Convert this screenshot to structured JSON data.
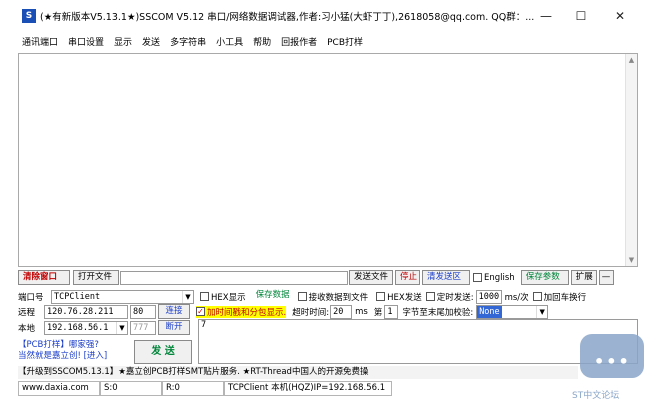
{
  "window": {
    "title": "(★有新版本V5.13.1★)SSCOM V5.12 串口/网络数据调试器,作者:习小猛(大虾丁丁),2618058@qq.com. QQ群：...",
    "minimize": "—",
    "maximize": "☐",
    "close": "✕"
  },
  "menu": [
    "通讯端口",
    "串口设置",
    "显示",
    "发送",
    "多字符串",
    "小工具",
    "帮助",
    "回报作者",
    "PCB打样"
  ],
  "toolbar": {
    "clear_window": "清除窗口",
    "open_file": "打开文件",
    "send_file": "发送文件",
    "stop": "停止",
    "clear_send_area": "清发送区",
    "english": "English",
    "save_params": "保存参数",
    "expand": "扩展",
    "collapse": "—"
  },
  "row1": {
    "port_label": "端口号",
    "port_value": "TCPClient",
    "hex_display": "HEX显示",
    "save_data": "保存数据",
    "recv_to_file": "接收数据到文件",
    "hex_send": "HEX发送",
    "timed_send": "定时发送:",
    "interval": "1000",
    "interval_unit": "ms/次",
    "add_crlf": "加回车换行"
  },
  "row2": {
    "remote_label": "远程",
    "remote_ip": "120.76.28.211",
    "remote_port": "80",
    "connect": "连接",
    "timestamp_label": "加时间戳和分包显示.",
    "timeout_label": "超时时间:",
    "timeout_value": "20",
    "timeout_unit": "ms",
    "nth_label": "第",
    "nth_value": "1",
    "checksum_label": "字节至末尾加校验:",
    "checksum_value": "None"
  },
  "row3": {
    "local_label": "本地",
    "local_ip": "192.168.56.1",
    "local_port": "777",
    "disconnect": "断开"
  },
  "promo": {
    "line1": "【PCB打样】哪家强?",
    "line2": "当然就是嘉立创! [进入]"
  },
  "send_button": "发 送",
  "send_text": "7",
  "ticker": "【升级到SSCOM5.13.1】★嘉立创PCB打样SMT贴片服务. ★RT-Thread中国人的开源免费操",
  "status": {
    "website": "www.daxia.com",
    "sent": "S:0",
    "received": "R:0",
    "connection": "TCPClient 本机(HQZ)IP=192.168.56.1"
  },
  "watermark": {
    "text": "ST中文论坛"
  }
}
